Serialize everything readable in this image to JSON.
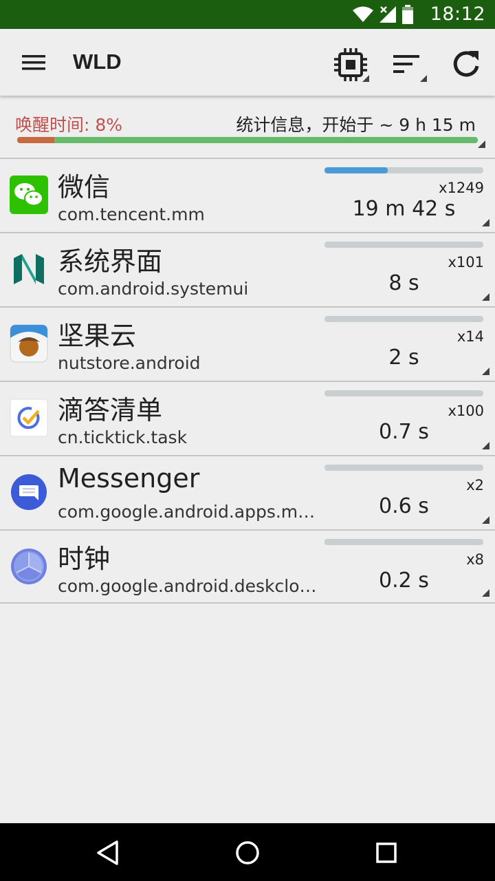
{
  "status_bar": {
    "time": "18:12"
  },
  "app_bar": {
    "title": "WLD",
    "actions": [
      "cpu-icon",
      "sort-icon",
      "refresh-icon"
    ]
  },
  "summary": {
    "awake_label": "唤醒时间: 8%",
    "awake_fraction": 0.08,
    "stats_label": "统计信息，开始于 ~ 9 h 15 m",
    "colors": {
      "awake": "#c8693f",
      "asleep": "#66bb6a"
    }
  },
  "apps": [
    {
      "name": "微信",
      "package": "com.tencent.mm",
      "count": "x1249",
      "duration": "19 m 42 s",
      "bar_fraction": 0.4,
      "icon": "wechat-icon"
    },
    {
      "name": "系统界面",
      "package": "com.android.systemui",
      "count": "x101",
      "duration": "8 s",
      "bar_fraction": 0,
      "icon": "android-n-icon"
    },
    {
      "name": "坚果云",
      "package": "nutstore.android",
      "count": "x14",
      "duration": "2 s",
      "bar_fraction": 0,
      "icon": "nutstore-icon"
    },
    {
      "name": "滴答清单",
      "package": "cn.ticktick.task",
      "count": "x100",
      "duration": "0.7 s",
      "bar_fraction": 0,
      "icon": "ticktick-icon"
    },
    {
      "name": "Messenger",
      "package": "com.google.android.apps.messaging",
      "count": "x2",
      "duration": "0.6 s",
      "bar_fraction": 0,
      "icon": "messenger-icon"
    },
    {
      "name": "时钟",
      "package": "com.google.android.deskclock",
      "count": "x8",
      "duration": "0.2 s",
      "bar_fraction": 0,
      "icon": "clock-icon"
    }
  ],
  "nav_bar": {
    "buttons": [
      "back-icon",
      "home-icon",
      "recents-icon"
    ]
  }
}
